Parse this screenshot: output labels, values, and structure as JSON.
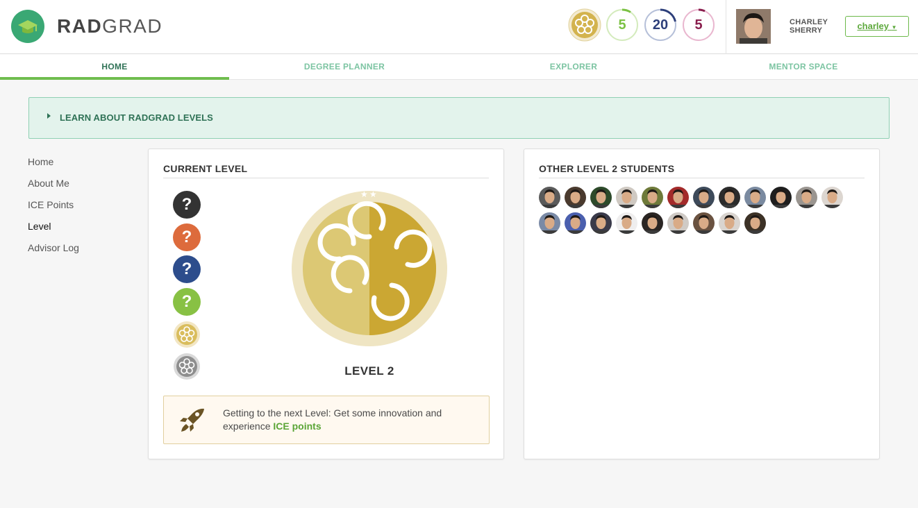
{
  "app": {
    "brand_bold": "RAD",
    "brand_light": "GRAD"
  },
  "header": {
    "ice": [
      {
        "type": "level-badge",
        "icon": "flower-badge-icon",
        "color": "#d0b350"
      },
      {
        "type": "innovation",
        "value": "5",
        "color": "#7bc143",
        "progress": 0.15
      },
      {
        "type": "competency",
        "value": "20",
        "color": "#2d3f7a",
        "progress": 0.35
      },
      {
        "type": "experience",
        "value": "5",
        "color": "#8a1f4e",
        "progress": 0.1
      }
    ],
    "user": {
      "first": "CHARLEY",
      "last": "SHERRY",
      "menu_label": "charley"
    }
  },
  "tabs": [
    {
      "label": "HOME",
      "active": true
    },
    {
      "label": "DEGREE PLANNER",
      "active": false
    },
    {
      "label": "EXPLORER",
      "active": false
    },
    {
      "label": "MENTOR SPACE",
      "active": false
    }
  ],
  "accordion": {
    "label": "LEARN ABOUT RADGRAD LEVELS"
  },
  "sidemenu": [
    {
      "label": "Home",
      "active": false
    },
    {
      "label": "About Me",
      "active": false
    },
    {
      "label": "ICE Points",
      "active": false
    },
    {
      "label": "Level",
      "active": true
    },
    {
      "label": "Advisor Log",
      "active": false
    }
  ],
  "current_level": {
    "title": "CURRENT LEVEL",
    "levels": [
      {
        "kind": "locked",
        "color": "#333333"
      },
      {
        "kind": "locked",
        "color": "#dd6b3c"
      },
      {
        "kind": "locked",
        "color": "#2d4d8c"
      },
      {
        "kind": "locked",
        "color": "#88c144"
      },
      {
        "kind": "badge",
        "color": "#d9bd5d"
      },
      {
        "kind": "badge",
        "color": "#9a9a9a"
      }
    ],
    "level_label": "LEVEL 2",
    "hint_text": "Getting to the next Level: Get some innovation and experience ",
    "hint_link": "ICE points"
  },
  "other_students": {
    "title": "OTHER LEVEL 2 STUDENTS",
    "avatars": [
      "#5a5a5a",
      "#4a3a2e",
      "#2d4a2a",
      "#cfc9c2",
      "#6e7a3a",
      "#a32a2a",
      "#3d4a5a",
      "#2b2b2b",
      "#7a8aa0",
      "#1e1e1e",
      "#9a9590",
      "#dcd6d0",
      "#7a8aa6",
      "#4a5fae",
      "#3a3a4a",
      "#efeeee",
      "#2a2523",
      "#cfcac5",
      "#6a5240",
      "#d9d4cf",
      "#3c3126"
    ]
  }
}
